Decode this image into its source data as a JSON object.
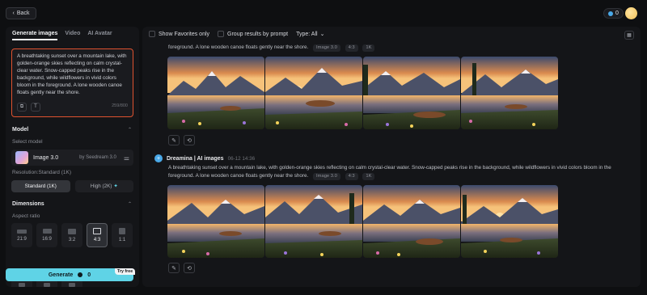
{
  "topbar": {
    "back_label": "Back",
    "credits": "0"
  },
  "left": {
    "tabs": [
      "Generate images",
      "Video",
      "AI Avatar"
    ],
    "prompt": {
      "text": "A breathtaking sunset over a mountain lake, with golden-orange skies reflecting on calm crystal-clear water. Snow-capped peaks rise in the background, while wildflowers in vivid colors bloom in the foreground. A lone wooden canoe floats gently near the shore.",
      "char_count": "259/800"
    },
    "model": {
      "heading": "Model",
      "select_label": "Select model",
      "name": "Image 3.0",
      "by": "by Seedream 3.0",
      "resolution_label": "Resolution:Standard (1K)",
      "resolution_options": [
        "Standard (1K)",
        "High (2K)"
      ]
    },
    "dimensions": {
      "heading": "Dimensions",
      "aspect_label": "Aspect ratio",
      "ratios": [
        "21:9",
        "16:9",
        "3:2",
        "4:3",
        "1:1"
      ],
      "selected_ratio": "4:3"
    },
    "generate": {
      "label": "Generate",
      "cost": "0",
      "badge": "Try free"
    }
  },
  "right": {
    "filters": {
      "show_favorites": "Show Favorites only",
      "group_by_prompt": "Group results by prompt",
      "type_label": "Type: All"
    },
    "generations": [
      {
        "prompt_tail": "foreground. A lone wooden canoe floats gently near the shore.",
        "tags": [
          "Image 3.0",
          "4:3",
          "1K"
        ]
      },
      {
        "source": "Dreamina | AI images",
        "time": "06-12 14:36",
        "prompt_line1": "A breathtaking sunset over a mountain lake, with golden-orange skies reflecting on calm crystal-clear water. Snow-capped peaks rise in the background, while wildflowers in vivid colors bloom in the",
        "prompt_line2": "foreground. A lone wooden canoe floats gently near the shore.",
        "tags": [
          "Image 3.0",
          "4:3",
          "1K"
        ]
      }
    ]
  },
  "colors": {
    "accent": "#5fd3e6",
    "prompt_border": "#e0532f",
    "panel": "#141518",
    "background": "#0e0f11"
  },
  "icons": [
    "chevron-left-icon",
    "credit-icon",
    "image-upload-icon",
    "text-format-icon",
    "tune-icon",
    "calendar-icon",
    "edit-icon",
    "regenerate-icon",
    "dreamina-logo-icon"
  ]
}
